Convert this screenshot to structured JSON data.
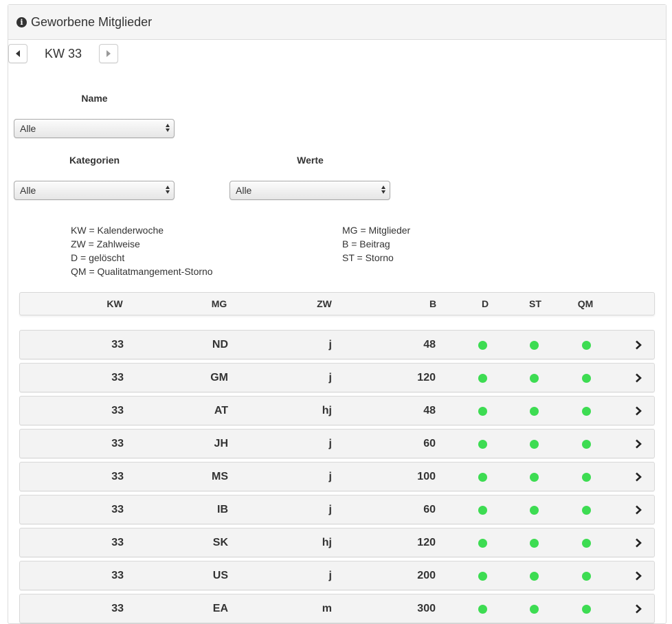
{
  "panel": {
    "title": "Geworbene Mitglieder",
    "icon": "info-circle-icon"
  },
  "week_nav": {
    "label": "KW 33",
    "prev_icon": "caret-left-icon",
    "next_icon": "caret-right-icon"
  },
  "filters": {
    "name": {
      "label": "Name",
      "value": "Alle"
    },
    "kategorien": {
      "label": "Kategorien",
      "value": "Alle"
    },
    "werte": {
      "label": "Werte",
      "value": "Alle"
    }
  },
  "legend": {
    "kw": "KW = Kalenderwoche",
    "zw": "ZW = Zahlweise",
    "d": "D = gelöscht",
    "qm": "QM = Qualitatmangement-Storno",
    "mg": "MG = Mitglieder",
    "b": "B = Beitrag",
    "st": "ST = Storno"
  },
  "table": {
    "headers": {
      "kw": "KW",
      "mg": "MG",
      "zw": "ZW",
      "b": "B",
      "d": "D",
      "st": "ST",
      "qm": "QM"
    },
    "status_color": "#3ddc52",
    "rows": [
      {
        "kw": "33",
        "mg": "ND",
        "zw": "j",
        "b": "48"
      },
      {
        "kw": "33",
        "mg": "GM",
        "zw": "j",
        "b": "120"
      },
      {
        "kw": "33",
        "mg": "AT",
        "zw": "hj",
        "b": "48"
      },
      {
        "kw": "33",
        "mg": "JH",
        "zw": "j",
        "b": "60"
      },
      {
        "kw": "33",
        "mg": "MS",
        "zw": "j",
        "b": "100"
      },
      {
        "kw": "33",
        "mg": "IB",
        "zw": "j",
        "b": "60"
      },
      {
        "kw": "33",
        "mg": "SK",
        "zw": "hj",
        "b": "120"
      },
      {
        "kw": "33",
        "mg": "US",
        "zw": "j",
        "b": "200"
      },
      {
        "kw": "33",
        "mg": "EA",
        "zw": "m",
        "b": "300"
      }
    ]
  }
}
